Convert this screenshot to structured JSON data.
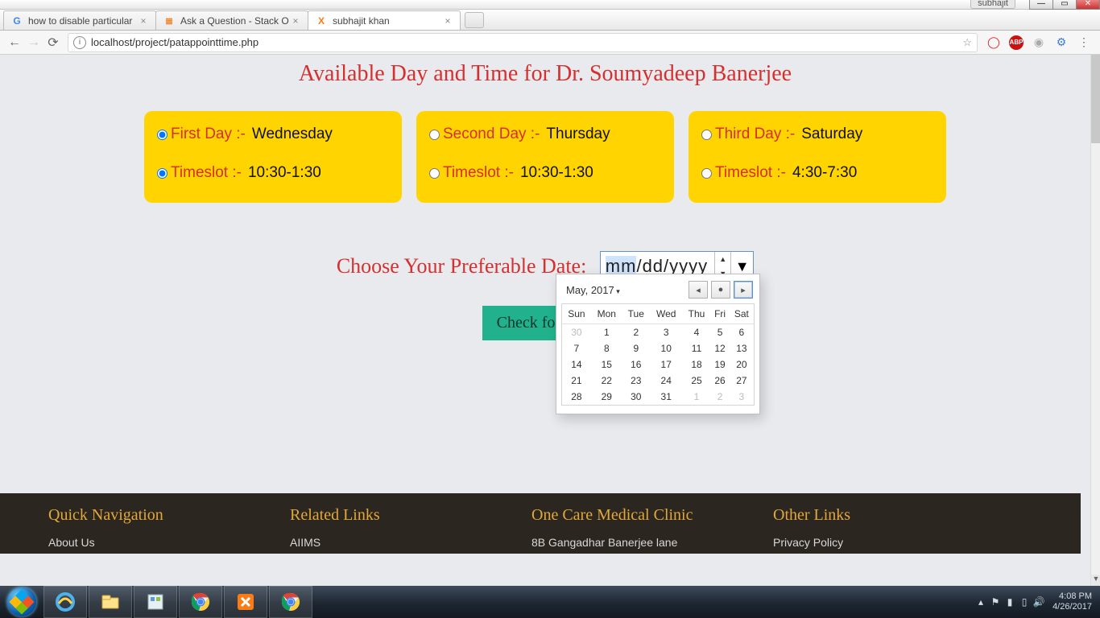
{
  "window": {
    "user": "subhajit"
  },
  "tabs": [
    {
      "label": "how to disable particular",
      "favicon": "G",
      "favcolor": "#4285F4"
    },
    {
      "label": "Ask a Question - Stack O",
      "favicon": "≣",
      "favcolor": "#f48024"
    },
    {
      "label": "subhajit khan",
      "favicon": "X",
      "favcolor": "#fb7c14",
      "active": true
    }
  ],
  "url": "localhost/project/patappointtime.php",
  "heading": "Available Day and Time for Dr. Soumyadeep Banerjee",
  "cards": [
    {
      "day_label": "First Day :-",
      "day_value": "Wednesday",
      "slot_label": "Timeslot :-",
      "slot_value": "10:30-1:30",
      "day_checked": true,
      "slot_checked": true
    },
    {
      "day_label": "Second Day :-",
      "day_value": "Thursday",
      "slot_label": "Timeslot :-",
      "slot_value": "10:30-1:30",
      "day_checked": false,
      "slot_checked": false
    },
    {
      "day_label": "Third Day :-",
      "day_value": "Saturday",
      "slot_label": "Timeslot :-",
      "slot_value": "4:30-7:30",
      "day_checked": false,
      "slot_checked": false
    }
  ],
  "date_label": "Choose Your Preferable Date:",
  "date_value": {
    "mm": "mm",
    "sep": "/",
    "dd": "dd",
    "yyyy": "yyyy"
  },
  "button": "Check for Avai",
  "calendar": {
    "month": "May, 2017",
    "dow": [
      "Sun",
      "Mon",
      "Tue",
      "Wed",
      "Thu",
      "Fri",
      "Sat"
    ],
    "rows": [
      [
        {
          "d": "30",
          "dim": true
        },
        {
          "d": "1"
        },
        {
          "d": "2"
        },
        {
          "d": "3"
        },
        {
          "d": "4"
        },
        {
          "d": "5"
        },
        {
          "d": "6"
        }
      ],
      [
        {
          "d": "7"
        },
        {
          "d": "8"
        },
        {
          "d": "9"
        },
        {
          "d": "10"
        },
        {
          "d": "11"
        },
        {
          "d": "12"
        },
        {
          "d": "13"
        }
      ],
      [
        {
          "d": "14"
        },
        {
          "d": "15"
        },
        {
          "d": "16"
        },
        {
          "d": "17"
        },
        {
          "d": "18"
        },
        {
          "d": "19"
        },
        {
          "d": "20"
        }
      ],
      [
        {
          "d": "21"
        },
        {
          "d": "22"
        },
        {
          "d": "23"
        },
        {
          "d": "24"
        },
        {
          "d": "25"
        },
        {
          "d": "26"
        },
        {
          "d": "27"
        }
      ],
      [
        {
          "d": "28"
        },
        {
          "d": "29"
        },
        {
          "d": "30"
        },
        {
          "d": "31"
        },
        {
          "d": "1",
          "dim": true
        },
        {
          "d": "2",
          "dim": true
        },
        {
          "d": "3",
          "dim": true
        }
      ]
    ]
  },
  "footer": {
    "cols": [
      {
        "title": "Quick Navigation",
        "link": "About Us"
      },
      {
        "title": "Related Links",
        "link": "AIIMS"
      },
      {
        "title": "One Care Medical Clinic",
        "link": "8B Gangadhar Banerjee lane"
      },
      {
        "title": "Other Links",
        "link": "Privacy Policy"
      }
    ]
  },
  "tray": {
    "time": "4:08 PM",
    "date": "4/26/2017"
  }
}
